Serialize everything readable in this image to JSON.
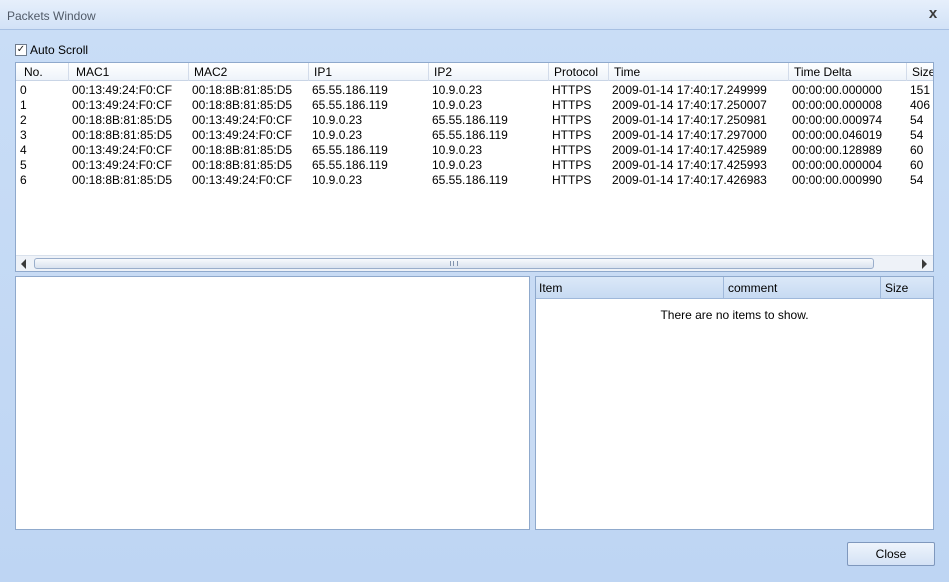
{
  "window": {
    "title": "Packets Window",
    "close_glyph": "x"
  },
  "auto_scroll": {
    "label": "Auto Scroll",
    "checked": true,
    "check_glyph": "✓"
  },
  "packets": {
    "columns": [
      "No.",
      "MAC1",
      "MAC2",
      "IP1",
      "IP2",
      "Protocol",
      "Time",
      "Time Delta",
      "Size"
    ],
    "rows": [
      [
        "0",
        "00:13:49:24:F0:CF",
        "00:18:8B:81:85:D5",
        "65.55.186.119",
        "10.9.0.23",
        "HTTPS",
        "2009-01-14 17:40:17.249999",
        "00:00:00.000000",
        "151"
      ],
      [
        "1",
        "00:13:49:24:F0:CF",
        "00:18:8B:81:85:D5",
        "65.55.186.119",
        "10.9.0.23",
        "HTTPS",
        "2009-01-14 17:40:17.250007",
        "00:00:00.000008",
        "406"
      ],
      [
        "2",
        "00:18:8B:81:85:D5",
        "00:13:49:24:F0:CF",
        "10.9.0.23",
        "65.55.186.119",
        "HTTPS",
        "2009-01-14 17:40:17.250981",
        "00:00:00.000974",
        "54"
      ],
      [
        "3",
        "00:18:8B:81:85:D5",
        "00:13:49:24:F0:CF",
        "10.9.0.23",
        "65.55.186.119",
        "HTTPS",
        "2009-01-14 17:40:17.297000",
        "00:00:00.046019",
        "54"
      ],
      [
        "4",
        "00:13:49:24:F0:CF",
        "00:18:8B:81:85:D5",
        "65.55.186.119",
        "10.9.0.23",
        "HTTPS",
        "2009-01-14 17:40:17.425989",
        "00:00:00.128989",
        "60"
      ],
      [
        "5",
        "00:13:49:24:F0:CF",
        "00:18:8B:81:85:D5",
        "65.55.186.119",
        "10.9.0.23",
        "HTTPS",
        "2009-01-14 17:40:17.425993",
        "00:00:00.000004",
        "60"
      ],
      [
        "6",
        "00:18:8B:81:85:D5",
        "00:13:49:24:F0:CF",
        "10.9.0.23",
        "65.55.186.119",
        "HTTPS",
        "2009-01-14 17:40:17.426983",
        "00:00:00.000990",
        "54"
      ]
    ]
  },
  "details": {
    "columns": [
      "Item",
      "comment",
      "Size"
    ],
    "empty_text": "There are no items to show."
  },
  "footer": {
    "close_label": "Close"
  },
  "icons": {
    "scroll_left": "scroll-left-icon",
    "scroll_right": "scroll-right-icon"
  },
  "colors": {
    "background": "#c4daf5",
    "border": "#8fa9cc"
  }
}
